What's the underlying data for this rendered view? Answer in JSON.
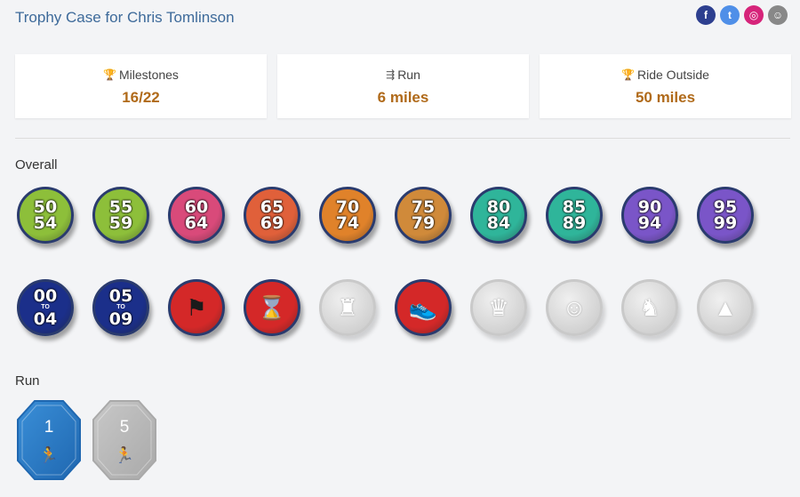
{
  "header": {
    "title": "Trophy Case for Chris Tomlinson",
    "social": [
      {
        "name": "facebook-icon",
        "glyph": "f",
        "color": "#2d3f8f"
      },
      {
        "name": "twitter-icon",
        "glyph": "t",
        "color": "#4f8fe8"
      },
      {
        "name": "instagram-icon",
        "glyph": "◎",
        "color": "#d6247a"
      },
      {
        "name": "share-icon",
        "glyph": "☺",
        "color": "#888888"
      }
    ]
  },
  "stats": [
    {
      "icon": "trophy-icon",
      "glyph": "🏆",
      "label": "Milestones",
      "value": "16/22"
    },
    {
      "icon": "running-icon",
      "glyph": "⇶",
      "label": "Run",
      "value": "6 miles"
    },
    {
      "icon": "trophy-icon",
      "glyph": "🏆",
      "label": "Ride Outside",
      "value": "50 miles"
    }
  ],
  "sections": {
    "overall": "Overall",
    "run": "Run"
  },
  "overall_row1": [
    {
      "top": "50",
      "bottom": "54",
      "bg": "#8dbf3a"
    },
    {
      "top": "55",
      "bottom": "59",
      "bg": "#8dbf3a"
    },
    {
      "top": "60",
      "bottom": "64",
      "bg": "#d94a7a"
    },
    {
      "top": "65",
      "bottom": "69",
      "bg": "#e0603a"
    },
    {
      "top": "70",
      "bottom": "74",
      "bg": "#e0822a"
    },
    {
      "top": "75",
      "bottom": "79",
      "bg": "#d08a3a"
    },
    {
      "top": "80",
      "bottom": "84",
      "bg": "#2fb59a"
    },
    {
      "top": "85",
      "bottom": "89",
      "bg": "#2fb59a"
    },
    {
      "top": "90",
      "bottom": "94",
      "bg": "#7a55c8"
    },
    {
      "top": "95",
      "bottom": "99",
      "bg": "#7a55c8"
    }
  ],
  "overall_row2": [
    {
      "top": "00",
      "mid": "TO",
      "bottom": "04",
      "bg": "#1b2f8a",
      "gray": false
    },
    {
      "top": "05",
      "mid": "TO",
      "bottom": "09",
      "bg": "#1b2f8a",
      "gray": false
    },
    {
      "icon": "flag",
      "bg": "#d42828",
      "gray": false
    },
    {
      "icon": "hourglass",
      "bg": "#d42828",
      "gray": false
    },
    {
      "icon": "boot",
      "bg": "#d0d0d0",
      "gray": true
    },
    {
      "icon": "shoe",
      "bg": "#d42828",
      "gray": false
    },
    {
      "icon": "crown",
      "bg": "#d0d0d0",
      "gray": true
    },
    {
      "icon": "smiley",
      "bg": "#d0d0d0",
      "gray": true
    },
    {
      "icon": "horse",
      "bg": "#d0d0d0",
      "gray": true
    },
    {
      "icon": "party-hat",
      "bg": "#d0d0d0",
      "gray": true
    }
  ],
  "run_badges": [
    {
      "value": "1",
      "color": "#3a8fd8",
      "earned": true
    },
    {
      "value": "5",
      "color": "#c8c8c8",
      "earned": false
    }
  ]
}
